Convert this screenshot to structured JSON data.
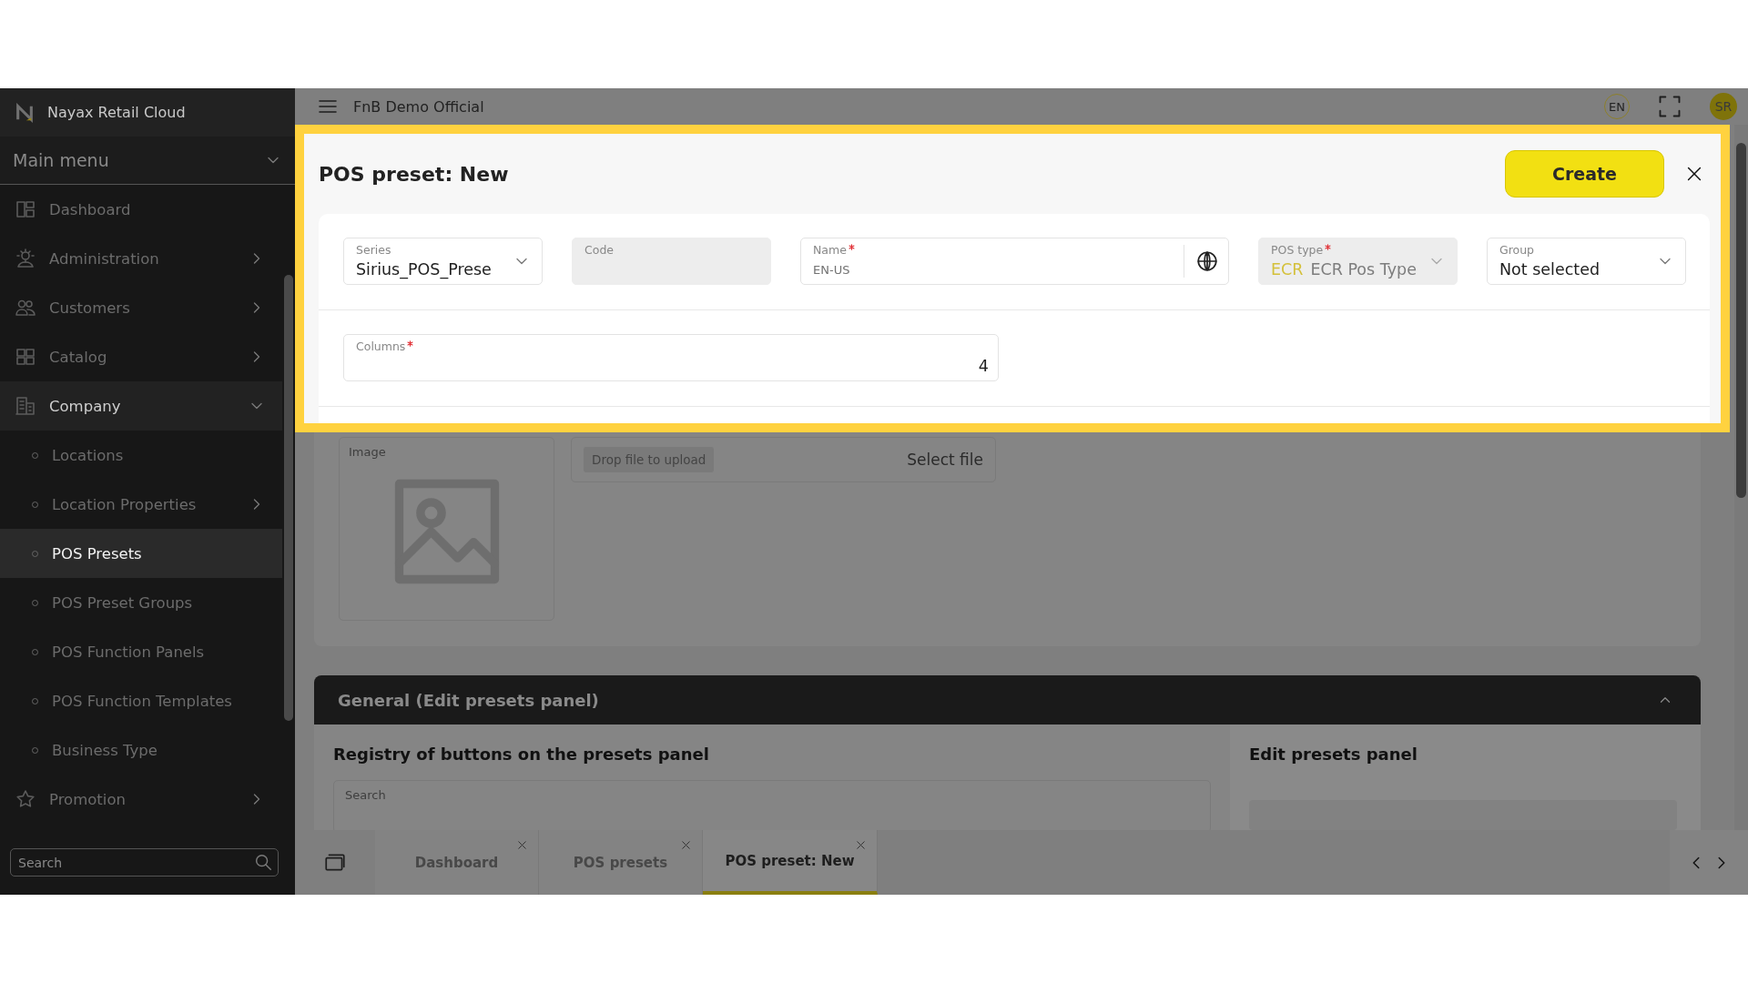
{
  "sidebar": {
    "brand": "Nayax Retail Cloud",
    "menu_title": "Main menu",
    "menu_expanded": true,
    "items": [
      {
        "label": "Dashboard",
        "selected": false
      },
      {
        "label": "Administration",
        "selected": false,
        "expanded": false
      },
      {
        "label": "Customers",
        "selected": false,
        "expanded": false
      },
      {
        "label": "Catalog",
        "selected": false,
        "expanded": false
      },
      {
        "label": "Company",
        "selected": false,
        "expanded": true,
        "children": [
          {
            "label": "Locations",
            "selected": false
          },
          {
            "label": "Location Properties",
            "selected": false,
            "expanded": false
          },
          {
            "label": "POS Presets",
            "selected": true
          },
          {
            "label": "POS Preset Groups",
            "selected": false
          },
          {
            "label": "POS Function Panels",
            "selected": false
          },
          {
            "label": "POS Function Templates",
            "selected": false
          },
          {
            "label": "Business Type",
            "selected": false
          }
        ]
      },
      {
        "label": "Promotion",
        "selected": false,
        "expanded": false
      }
    ],
    "search": {
      "placeholder": "Search"
    }
  },
  "header": {
    "title": "FnB Demo Official",
    "language": "EN",
    "avatar": "SR"
  },
  "form": {
    "title": "POS preset: New",
    "create_button": "Create",
    "fields": [
      {
        "kind": "select",
        "label": "Series",
        "required": false,
        "disabled": false,
        "value": "Sirius_POS_Prese"
      },
      {
        "kind": "text",
        "label": "Code",
        "required": false,
        "disabled": true
      },
      {
        "kind": "localized",
        "label": "Name",
        "required": true,
        "disabled": false,
        "placeholder": "EN-US"
      },
      {
        "kind": "select",
        "label": "POS type",
        "required": true,
        "disabled": true,
        "code": "ECR",
        "value": "ECR Pos Type"
      },
      {
        "kind": "select",
        "label": "Group",
        "required": false,
        "disabled": false,
        "value": "Not selected"
      }
    ],
    "columns_field": {
      "label": "Columns",
      "required": true,
      "value": "4"
    },
    "image": {
      "label": "Image"
    },
    "upload": {
      "hint": "Drop file to upload",
      "button": "Select file"
    }
  },
  "panel": {
    "title": "General (Edit presets panel)",
    "expanded": true,
    "left_title": "Registry of buttons on the presets panel",
    "search": {
      "placeholder": "Search"
    },
    "right_title": "Edit presets panel"
  },
  "tabs": [
    {
      "label": "Dashboard",
      "selected": false
    },
    {
      "label": "POS presets",
      "selected": false
    },
    {
      "label": "POS preset: New",
      "selected": true
    }
  ]
}
